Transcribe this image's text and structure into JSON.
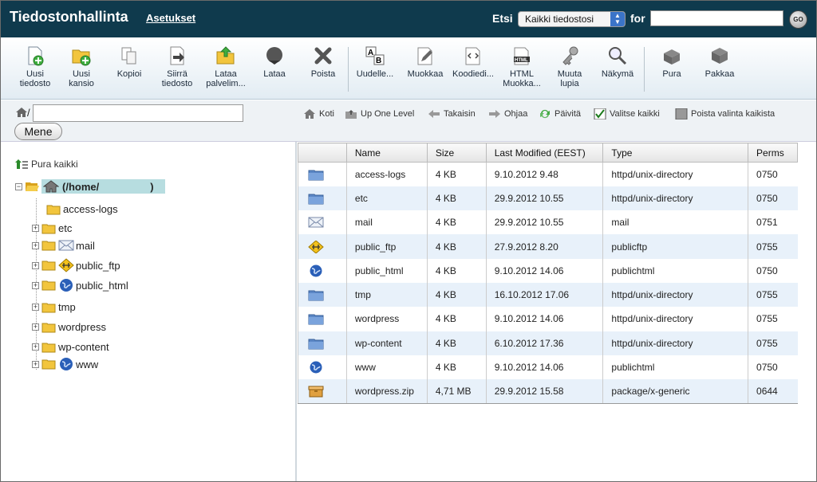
{
  "header": {
    "app_title": "Tiedostonhallinta",
    "settings_link": "Asetukset",
    "search_label": "Etsi",
    "search_scope": "Kaikki tiedostosi",
    "for_label": "for",
    "search_value": "",
    "go_label": "GO"
  },
  "toolbar": {
    "new_file": [
      "Uusi",
      "tiedosto"
    ],
    "new_folder": [
      "Uusi",
      "kansio"
    ],
    "copy": "Kopioi",
    "move_file": [
      "Siirrä",
      "tiedosto"
    ],
    "upload": [
      "Lataa",
      "palvelim..."
    ],
    "download": "Lataa",
    "delete": "Poista",
    "rename": "Uudelle...",
    "edit": "Muokkaa",
    "code_editor": "Koodiedi...",
    "html_editor": [
      "HTML",
      "Muokka..."
    ],
    "permissions": [
      "Muuta",
      "lupia"
    ],
    "view": "Näkymä",
    "extract": "Pura",
    "compress": "Pakkaa",
    "icon_html_text": "HTML"
  },
  "nav": {
    "path_prefix": "/",
    "path_value": "",
    "go_button": "Mene",
    "home": "Koti",
    "up_one_level": "Up One Level",
    "back": "Takaisin",
    "forward": "Ohjaa",
    "reload": "Päivitä",
    "select_all": "Valitse kaikki",
    "deselect_all": "Poista valinta kaikista"
  },
  "tree": {
    "collapse_all": "Pura kaikki",
    "root": "(/home/",
    "root_suffix": ")",
    "items": [
      {
        "label": "access-logs",
        "icon": "folder-icon",
        "expandable": false
      },
      {
        "label": "etc",
        "icon": "folder-icon",
        "expandable": true
      },
      {
        "label": "mail",
        "icon": "mail-icon",
        "expandable": true
      },
      {
        "label": "public_ftp",
        "icon": "ftp-icon",
        "expandable": true
      },
      {
        "label": "public_html",
        "icon": "globe-icon",
        "expandable": true
      },
      {
        "label": "tmp",
        "icon": "folder-icon",
        "expandable": true
      },
      {
        "label": "wordpress",
        "icon": "folder-icon",
        "expandable": true
      },
      {
        "label": "wp-content",
        "icon": "folder-icon",
        "expandable": true
      },
      {
        "label": "www",
        "icon": "globe-icon",
        "expandable": true
      }
    ]
  },
  "table": {
    "columns": [
      "",
      "Name",
      "Size",
      "Last Modified (EEST)",
      "Type",
      "Perms"
    ],
    "rows": [
      {
        "icon": "folder-icon",
        "name": "access-logs",
        "size": "4 KB",
        "modified": "9.10.2012 9.48",
        "type": "httpd/unix-directory",
        "perms": "0750"
      },
      {
        "icon": "folder-icon",
        "name": "etc",
        "size": "4 KB",
        "modified": "29.9.2012 10.55",
        "type": "httpd/unix-directory",
        "perms": "0750"
      },
      {
        "icon": "mail-icon",
        "name": "mail",
        "size": "4 KB",
        "modified": "29.9.2012 10.55",
        "type": "mail",
        "perms": "0751"
      },
      {
        "icon": "ftp-icon",
        "name": "public_ftp",
        "size": "4 KB",
        "modified": "27.9.2012 8.20",
        "type": "publicftp",
        "perms": "0755"
      },
      {
        "icon": "globe-icon",
        "name": "public_html",
        "size": "4 KB",
        "modified": "9.10.2012 14.06",
        "type": "publichtml",
        "perms": "0750"
      },
      {
        "icon": "folder-icon",
        "name": "tmp",
        "size": "4 KB",
        "modified": "16.10.2012 17.06",
        "type": "httpd/unix-directory",
        "perms": "0755"
      },
      {
        "icon": "folder-icon",
        "name": "wordpress",
        "size": "4 KB",
        "modified": "9.10.2012 14.06",
        "type": "httpd/unix-directory",
        "perms": "0755"
      },
      {
        "icon": "folder-icon",
        "name": "wp-content",
        "size": "4 KB",
        "modified": "6.10.2012 17.36",
        "type": "httpd/unix-directory",
        "perms": "0755"
      },
      {
        "icon": "globe-icon",
        "name": "www",
        "size": "4 KB",
        "modified": "9.10.2012 14.06",
        "type": "publichtml",
        "perms": "0750"
      },
      {
        "icon": "package-icon",
        "name": "wordpress.zip",
        "size": "4,71 MB",
        "modified": "29.9.2012 15.58",
        "type": "package/x-generic",
        "perms": "0644"
      }
    ]
  },
  "colors": {
    "header_bg": "#0f3a4d",
    "tree_selected_bg": "#b7dde0",
    "row_alt_bg": "#e8f1fa"
  }
}
